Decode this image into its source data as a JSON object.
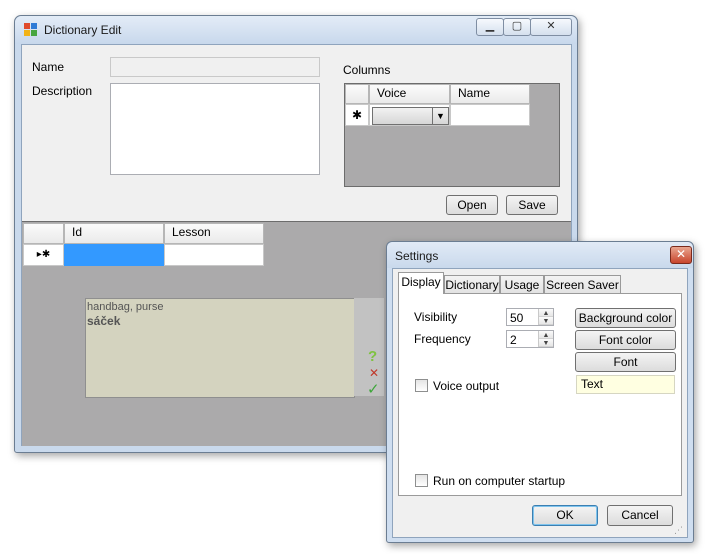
{
  "dictionary_window": {
    "title": "Dictionary Edit",
    "name_label": "Name",
    "name_value": "",
    "description_label": "Description",
    "description_value": "",
    "columns_label": "Columns",
    "columns_grid": {
      "headers": [
        "Voice",
        "Name"
      ],
      "new_row_marker": "✱",
      "voice_value": "",
      "name_value": ""
    },
    "open_button": "Open",
    "save_button": "Save",
    "lessons_grid": {
      "headers": [
        "Id",
        "Lesson"
      ],
      "row_marker": "▸✱",
      "id_value": "",
      "lesson_value": ""
    },
    "preview_card": {
      "meaning": "handbag, purse",
      "word": "sáček"
    },
    "side_icons": {
      "question": "?",
      "cross": "✕",
      "check": "✓"
    }
  },
  "settings_dialog": {
    "title": "Settings",
    "close_glyph": "✕",
    "tabs": [
      "Display",
      "Dictionary",
      "Usage",
      "Screen Saver"
    ],
    "active_tab": "Display",
    "visibility_label": "Visibility",
    "visibility_value": "50",
    "frequency_label": "Frequency",
    "frequency_value": "2",
    "background_color_button": "Background color",
    "font_color_button": "Font color",
    "font_button": "Font",
    "text_sample": "Text",
    "voice_output_label": "Voice output",
    "voice_output_checked": false,
    "run_on_startup_label": "Run on computer startup",
    "run_on_startup_checked": false,
    "ok_button": "OK",
    "cancel_button": "Cancel"
  },
  "colors": {
    "grid_background": "#abaaab",
    "preview_background": "#d4d3bf",
    "selected_cell": "#3399ff",
    "text_sample_background": "#ffffe1",
    "question_icon": "#7fc241",
    "cross_icon": "#c0392b",
    "check_icon": "#3ea63b"
  }
}
